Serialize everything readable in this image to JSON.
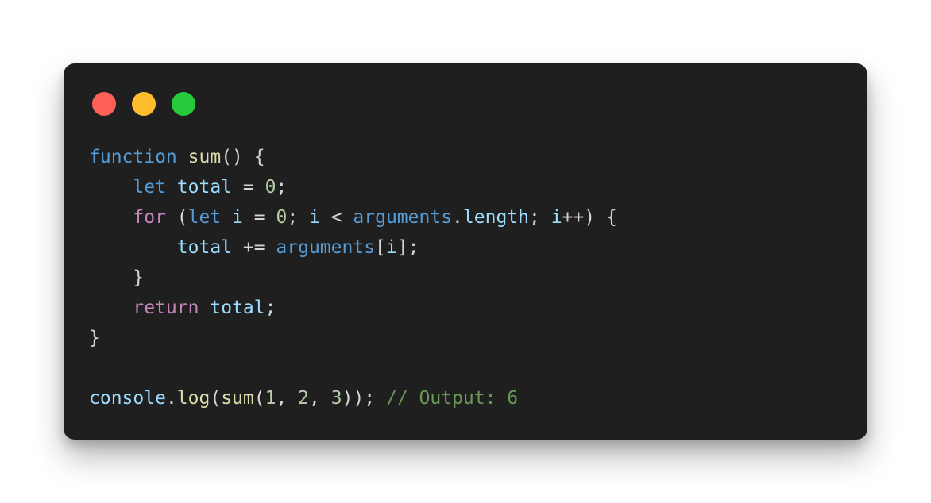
{
  "window": {
    "controls": [
      {
        "name": "close-dot",
        "color": "#ff5f56"
      },
      {
        "name": "minimize-dot",
        "color": "#ffbd2e"
      },
      {
        "name": "maximize-dot",
        "color": "#27c93f"
      }
    ]
  },
  "colors": {
    "keyword": "#569cd6",
    "control": "#c586c0",
    "function": "#dcdcaa",
    "variable": "#9cdcfe",
    "number": "#b5cea8",
    "punct": "#d4d4d4",
    "comment": "#6a9955",
    "background": "#1f1f1f"
  },
  "code": {
    "lines": [
      [
        {
          "t": "function",
          "k": "keyword"
        },
        {
          "t": " ",
          "k": "plain"
        },
        {
          "t": "sum",
          "k": "function"
        },
        {
          "t": "() {",
          "k": "punct"
        }
      ],
      [
        {
          "t": "    ",
          "k": "plain"
        },
        {
          "t": "let",
          "k": "keyword"
        },
        {
          "t": " ",
          "k": "plain"
        },
        {
          "t": "total",
          "k": "variable"
        },
        {
          "t": " = ",
          "k": "punct"
        },
        {
          "t": "0",
          "k": "number"
        },
        {
          "t": ";",
          "k": "punct"
        }
      ],
      [
        {
          "t": "    ",
          "k": "plain"
        },
        {
          "t": "for",
          "k": "control"
        },
        {
          "t": " (",
          "k": "punct"
        },
        {
          "t": "let",
          "k": "keyword"
        },
        {
          "t": " ",
          "k": "plain"
        },
        {
          "t": "i",
          "k": "variable"
        },
        {
          "t": " = ",
          "k": "punct"
        },
        {
          "t": "0",
          "k": "number"
        },
        {
          "t": "; ",
          "k": "punct"
        },
        {
          "t": "i",
          "k": "variable"
        },
        {
          "t": " < ",
          "k": "punct"
        },
        {
          "t": "arguments",
          "k": "keyword"
        },
        {
          "t": ".",
          "k": "punct"
        },
        {
          "t": "length",
          "k": "variable"
        },
        {
          "t": "; ",
          "k": "punct"
        },
        {
          "t": "i",
          "k": "variable"
        },
        {
          "t": "++) {",
          "k": "punct"
        }
      ],
      [
        {
          "t": "        ",
          "k": "plain"
        },
        {
          "t": "total",
          "k": "variable"
        },
        {
          "t": " += ",
          "k": "punct"
        },
        {
          "t": "arguments",
          "k": "keyword"
        },
        {
          "t": "[",
          "k": "punct"
        },
        {
          "t": "i",
          "k": "variable"
        },
        {
          "t": "];",
          "k": "punct"
        }
      ],
      [
        {
          "t": "    ",
          "k": "plain"
        },
        {
          "t": "}",
          "k": "punct"
        }
      ],
      [
        {
          "t": "    ",
          "k": "plain"
        },
        {
          "t": "return",
          "k": "control"
        },
        {
          "t": " ",
          "k": "plain"
        },
        {
          "t": "total",
          "k": "variable"
        },
        {
          "t": ";",
          "k": "punct"
        }
      ],
      [
        {
          "t": "}",
          "k": "punct"
        }
      ],
      [],
      [
        {
          "t": "console",
          "k": "variable"
        },
        {
          "t": ".",
          "k": "punct"
        },
        {
          "t": "log",
          "k": "function"
        },
        {
          "t": "(",
          "k": "punct"
        },
        {
          "t": "sum",
          "k": "function"
        },
        {
          "t": "(",
          "k": "punct"
        },
        {
          "t": "1",
          "k": "number"
        },
        {
          "t": ", ",
          "k": "punct"
        },
        {
          "t": "2",
          "k": "number"
        },
        {
          "t": ", ",
          "k": "punct"
        },
        {
          "t": "3",
          "k": "number"
        },
        {
          "t": ")); ",
          "k": "punct"
        },
        {
          "t": "// Output: 6",
          "k": "comment"
        }
      ]
    ]
  }
}
